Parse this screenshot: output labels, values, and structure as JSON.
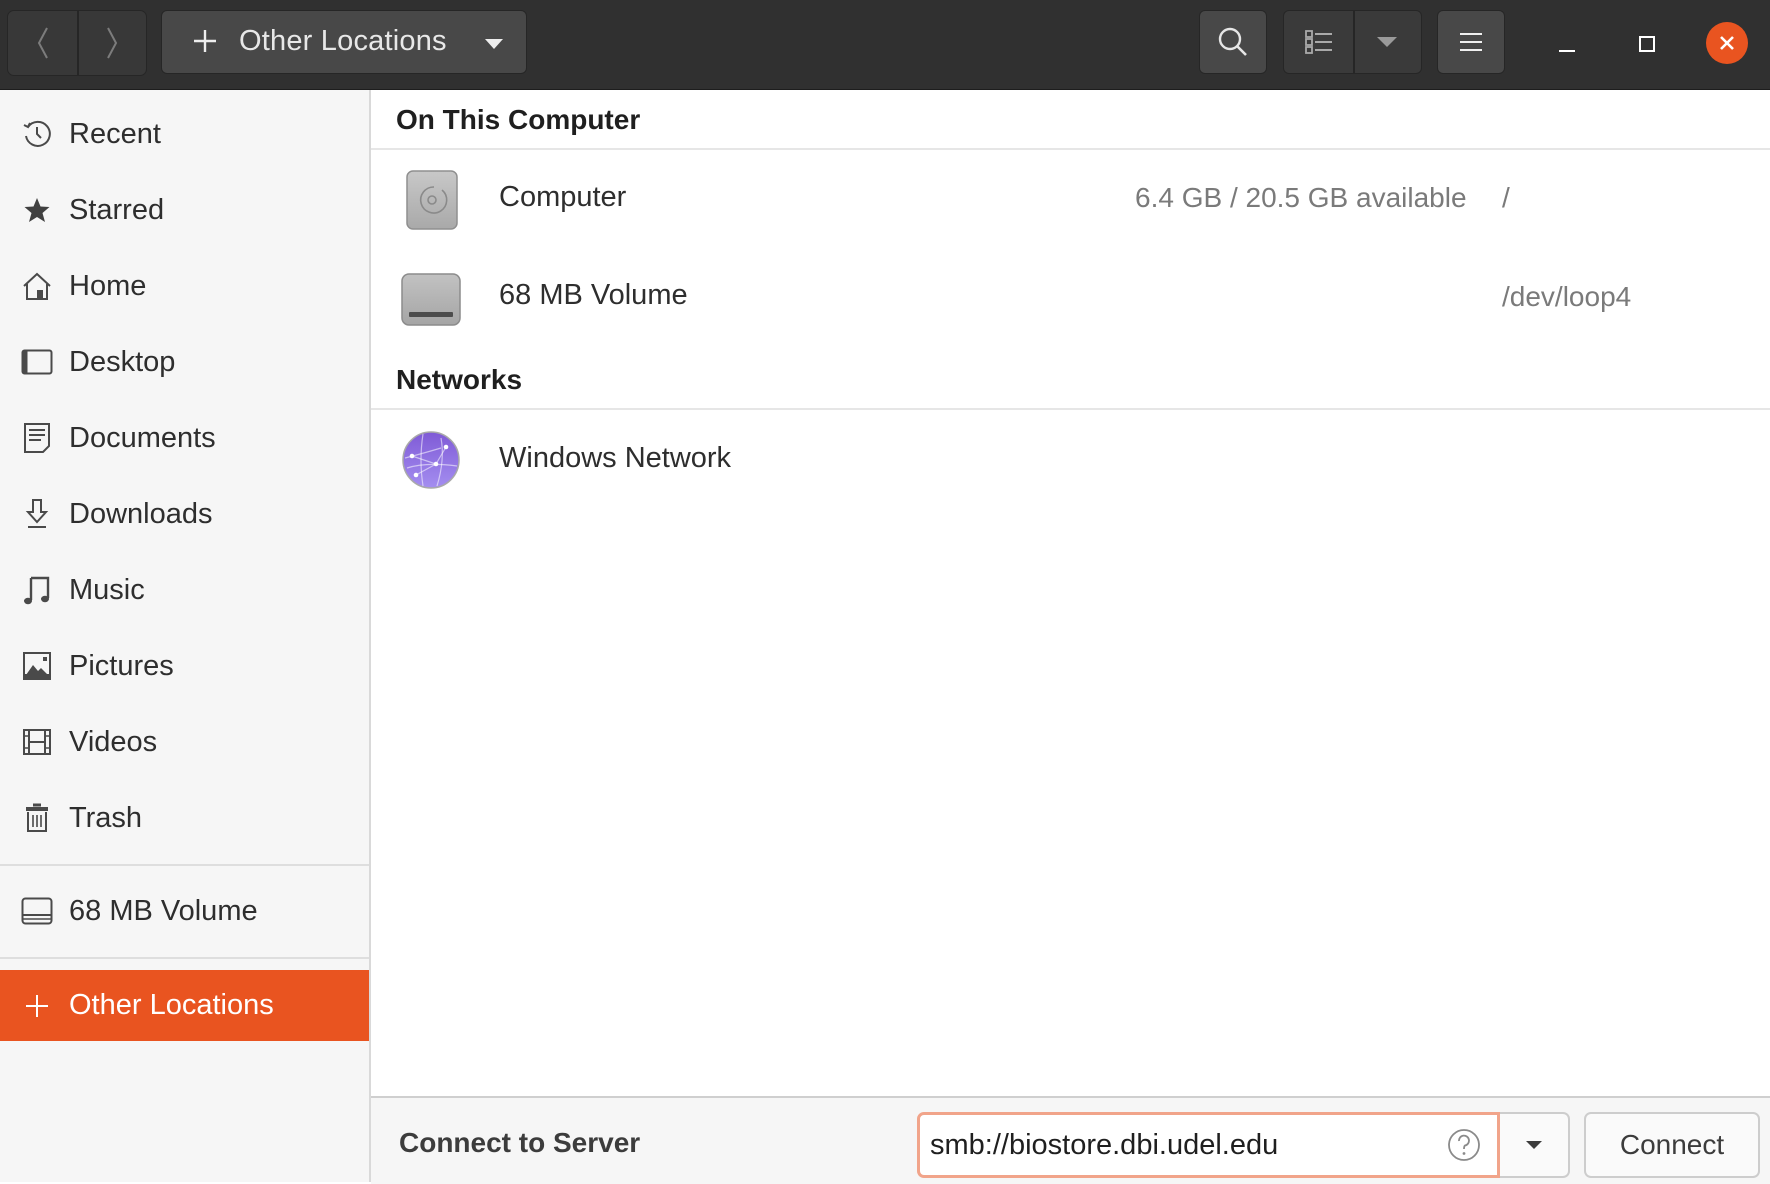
{
  "header": {
    "back_icon": "chevron-left-icon",
    "forward_icon": "chevron-right-icon",
    "path_icon": "plus-icon",
    "path_label": "Other Locations",
    "path_menu_icon": "caret-down-icon",
    "search_icon": "search-icon",
    "view_icon": "list-view-icon",
    "view_options_icon": "caret-down-icon",
    "menu_icon": "hamburger-menu-icon",
    "window_controls": [
      "minimize",
      "maximize",
      "close"
    ],
    "accent_color": "#e95420"
  },
  "sidebar": {
    "items": [
      {
        "label": "Recent",
        "icon": "clock-icon"
      },
      {
        "label": "Starred",
        "icon": "star-icon"
      },
      {
        "label": "Home",
        "icon": "home-icon"
      },
      {
        "label": "Desktop",
        "icon": "desktop-icon"
      },
      {
        "label": "Documents",
        "icon": "document-icon"
      },
      {
        "label": "Downloads",
        "icon": "download-icon"
      },
      {
        "label": "Music",
        "icon": "music-icon"
      },
      {
        "label": "Pictures",
        "icon": "picture-icon"
      },
      {
        "label": "Videos",
        "icon": "film-icon"
      },
      {
        "label": "Trash",
        "icon": "trash-icon"
      }
    ],
    "devices": [
      {
        "label": "68 MB Volume",
        "icon": "drive-icon"
      }
    ],
    "other_locations": {
      "label": "Other Locations",
      "icon": "plus-icon",
      "active": true
    }
  },
  "main": {
    "sections": [
      {
        "title": "On This Computer",
        "rows": [
          {
            "name": "Computer",
            "available": "6.4 GB / 20.5 GB available",
            "mount": "/",
            "icon": "harddisk-icon"
          },
          {
            "name": "68 MB Volume",
            "available": "",
            "mount": "/dev/loop4",
            "icon": "removable-drive-icon"
          }
        ]
      },
      {
        "title": "Networks",
        "rows": [
          {
            "name": "Windows Network",
            "available": "",
            "mount": "",
            "icon": "network-globe-icon"
          }
        ]
      }
    ]
  },
  "bottombar": {
    "label": "Connect to Server",
    "server_value": "smb://biostore.dbi.udel.edu",
    "help_icon": "help-icon",
    "recent_servers_icon": "caret-down-icon",
    "connect_label": "Connect"
  }
}
